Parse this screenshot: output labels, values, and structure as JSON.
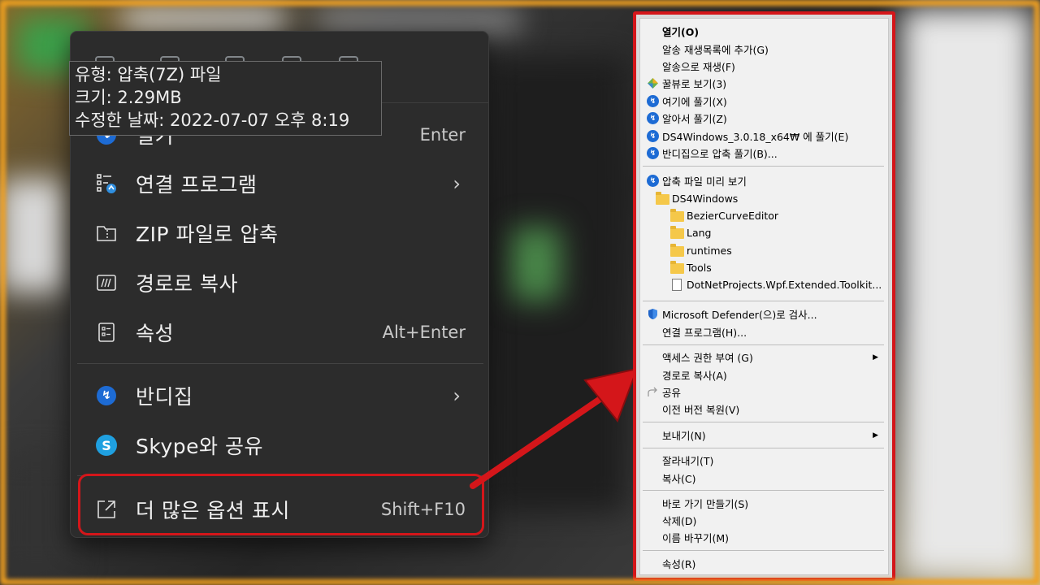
{
  "tooltip": {
    "type_line": "유형: 압축(7Z) 파일",
    "size_line": "크기: 2.29MB",
    "modified_line": "수정한 날짜: 2022-07-07 오후 8:19"
  },
  "win11_menu": {
    "items": [
      {
        "label": "열기",
        "shortcut": "Enter",
        "icon": "bandizip-icon"
      },
      {
        "label": "연결 프로그램",
        "icon": "open-with-icon",
        "submenu": true
      },
      {
        "label": "ZIP 파일로 압축",
        "icon": "zip-icon"
      },
      {
        "label": "경로로 복사",
        "icon": "copy-path-icon"
      },
      {
        "label": "속성",
        "shortcut": "Alt+Enter",
        "icon": "properties-icon"
      },
      {
        "label": "반디집",
        "icon": "bandizip-icon",
        "submenu": true
      },
      {
        "label": "Skype와 공유",
        "icon": "skype-icon"
      },
      {
        "label": "더 많은 옵션 표시",
        "shortcut": "Shift+F10",
        "icon": "more-options-icon"
      }
    ],
    "chevron": "›"
  },
  "classic_menu": {
    "open": "열기(O)",
    "add_to_playlist": "알송 재생목록에 추가(G)",
    "play_with_alsong": "알송으로 재생(F)",
    "view_honeyview": "꿀뷰로 보기(3)",
    "extract_here": "여기에 풀기(X)",
    "extract_smart": "알아서 풀기(Z)",
    "extract_to_folder": "DS4Windows_3.0.18_x64₩ 에 풀기(E)",
    "extract_bandizip": "반디집으로 압축 풀기(B)...",
    "preview": "압축 파일 미리 보기",
    "tree": {
      "root": "DS4Windows",
      "children": [
        "BezierCurveEditor",
        "Lang",
        "runtimes",
        "Tools"
      ],
      "file": "DotNetProjects.Wpf.Extended.Toolkit..."
    },
    "defender": "Microsoft Defender(으)로 검사...",
    "open_with": "연결 프로그램(H)...",
    "give_access": "액세스 권한 부여 (G)",
    "copy_path": "경로로 복사(A)",
    "share": "공유",
    "restore_prev": "이전 버전 복원(V)",
    "send_to": "보내기(N)",
    "cut": "잘라내기(T)",
    "copy": "복사(C)",
    "create_shortcut": "바로 가기 만들기(S)",
    "delete": "삭제(D)",
    "rename": "이름 바꾸기(M)",
    "properties": "속성(R)",
    "submenu_arrow": "▶"
  },
  "colors": {
    "highlight_red": "#d4161a",
    "frame_orange": "#f0a020",
    "menu_dark": "#2c2c2c",
    "classic_bg": "#f1f1f1",
    "bandizip_blue": "#1d6bd4"
  }
}
